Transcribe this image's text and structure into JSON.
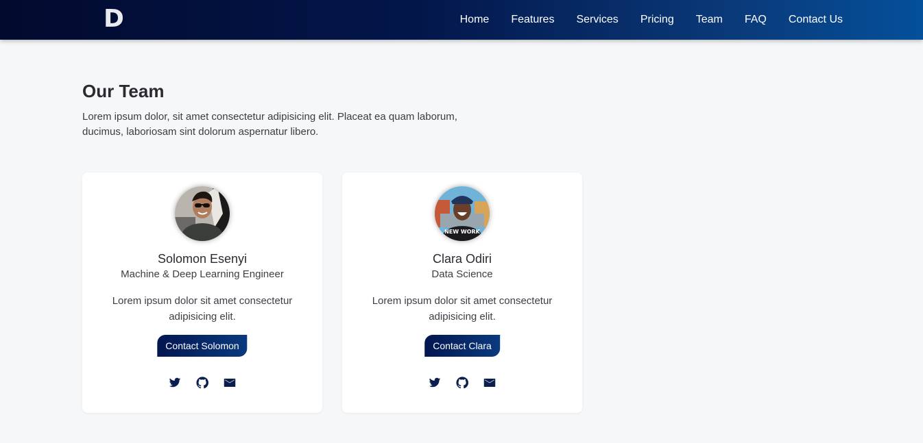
{
  "header": {
    "logo": "D",
    "nav": [
      "Home",
      "Features",
      "Services",
      "Pricing",
      "Team",
      "FAQ",
      "Contact Us"
    ]
  },
  "section": {
    "title": "Our Team",
    "description": "Lorem ipsum dolor, sit amet consectetur adipisicing elit. Placeat ea quam laborum, ducimus, laboriosam sint dolorum aspernatur libero."
  },
  "team": [
    {
      "name": "Solomon Esenyi",
      "role": "Machine & Deep Learning Engineer",
      "bio": "Lorem ipsum dolor sit amet consectetur adipisicing elit.",
      "button": "Contact Solomon",
      "icons": [
        "twitter-icon",
        "github-icon",
        "mail-icon"
      ]
    },
    {
      "name": "Clara Odiri",
      "role": "Data Science",
      "bio": "Lorem ipsum dolor sit amet consectetur adipisicing elit.",
      "button": "Contact Clara",
      "shirt_text": "NEW WORK",
      "icons": [
        "twitter-icon",
        "github-icon",
        "mail-icon"
      ]
    }
  ],
  "colors": {
    "header_start": "#020a2e",
    "header_end": "#04509a",
    "button": "#031650",
    "icon": "#0a1f4d",
    "background": "#f6f7f9"
  }
}
